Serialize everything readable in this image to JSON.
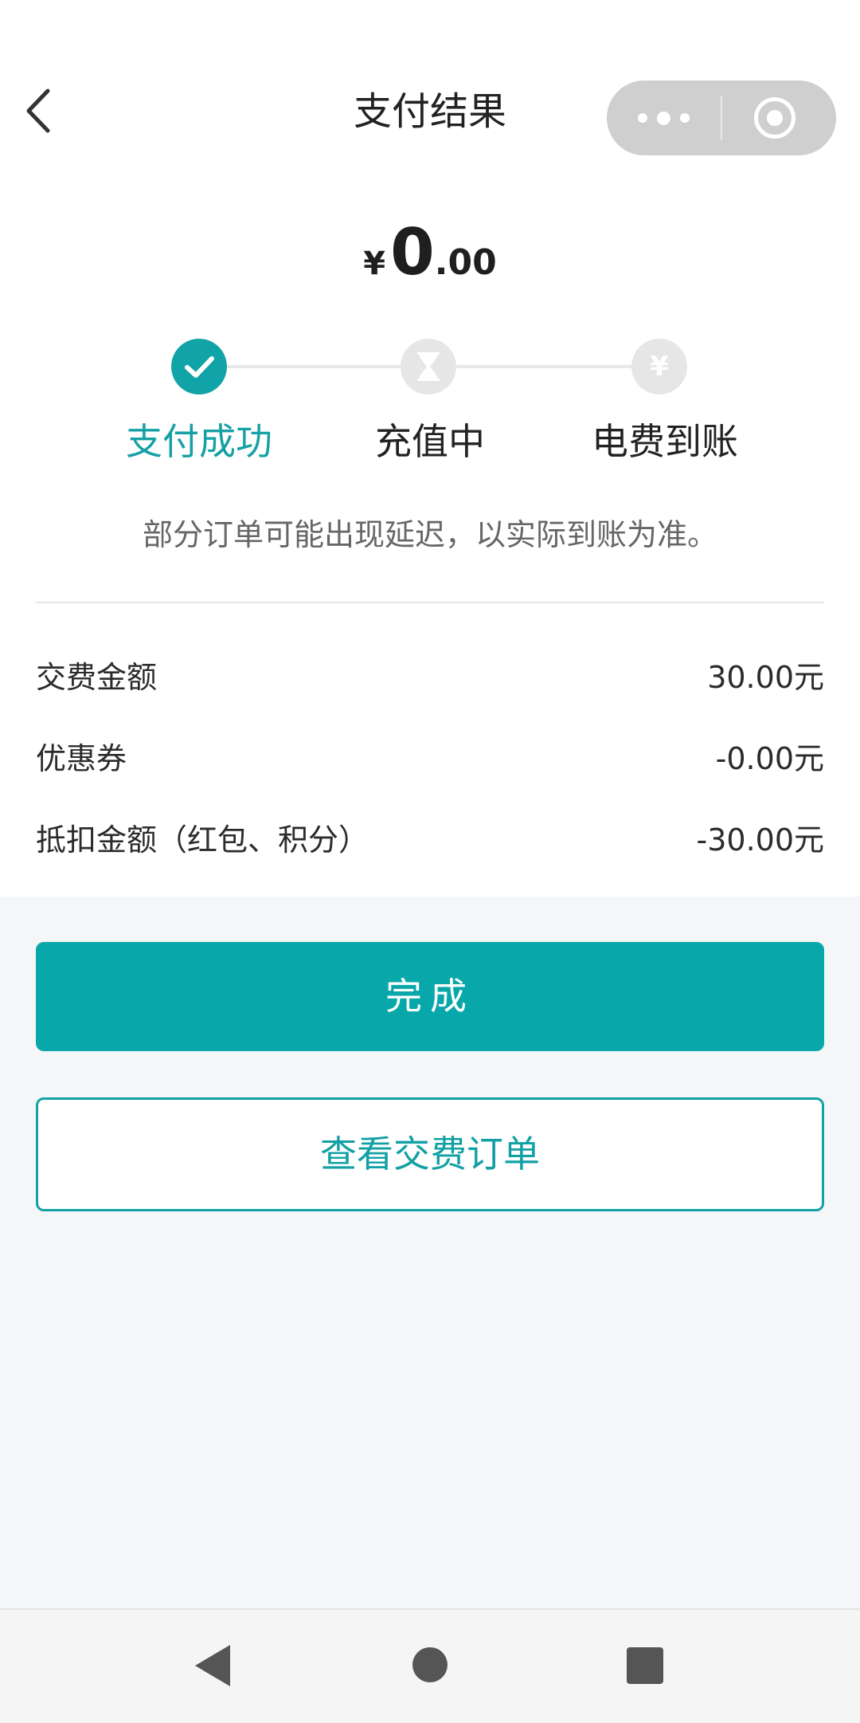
{
  "header": {
    "title": "支付结果",
    "back_icon": "chevron-left-icon",
    "capsule": {
      "more_icon": "more-dots-icon",
      "close_icon": "target-close-icon"
    }
  },
  "payment": {
    "currency_symbol": "¥",
    "amount_integer": "0",
    "amount_decimal": ".00"
  },
  "steps": [
    {
      "label": "支付成功",
      "icon": "check-icon",
      "status": "done"
    },
    {
      "label": "充值中",
      "icon": "hourglass-icon",
      "status": "pending"
    },
    {
      "label": "电费到账",
      "icon": "yen-icon",
      "status": "pending"
    }
  ],
  "notice": "部分订单可能出现延迟，以实际到账为准。",
  "details": [
    {
      "label": "交费金额",
      "value": "30.00元"
    },
    {
      "label": "优惠券",
      "value": "-0.00元"
    },
    {
      "label": "抵扣金额（红包、积分）",
      "value": "-30.00元"
    }
  ],
  "actions": {
    "done_label": "完成",
    "view_order_label": "查看交费订单"
  },
  "colors": {
    "accent": "#08a7aa",
    "accent_text": "#16a0a5",
    "background": "#f5f6f8"
  },
  "system_nav": {
    "back_icon": "nav-back-triangle-icon",
    "home_icon": "nav-home-circle-icon",
    "recent_icon": "nav-recent-square-icon"
  }
}
